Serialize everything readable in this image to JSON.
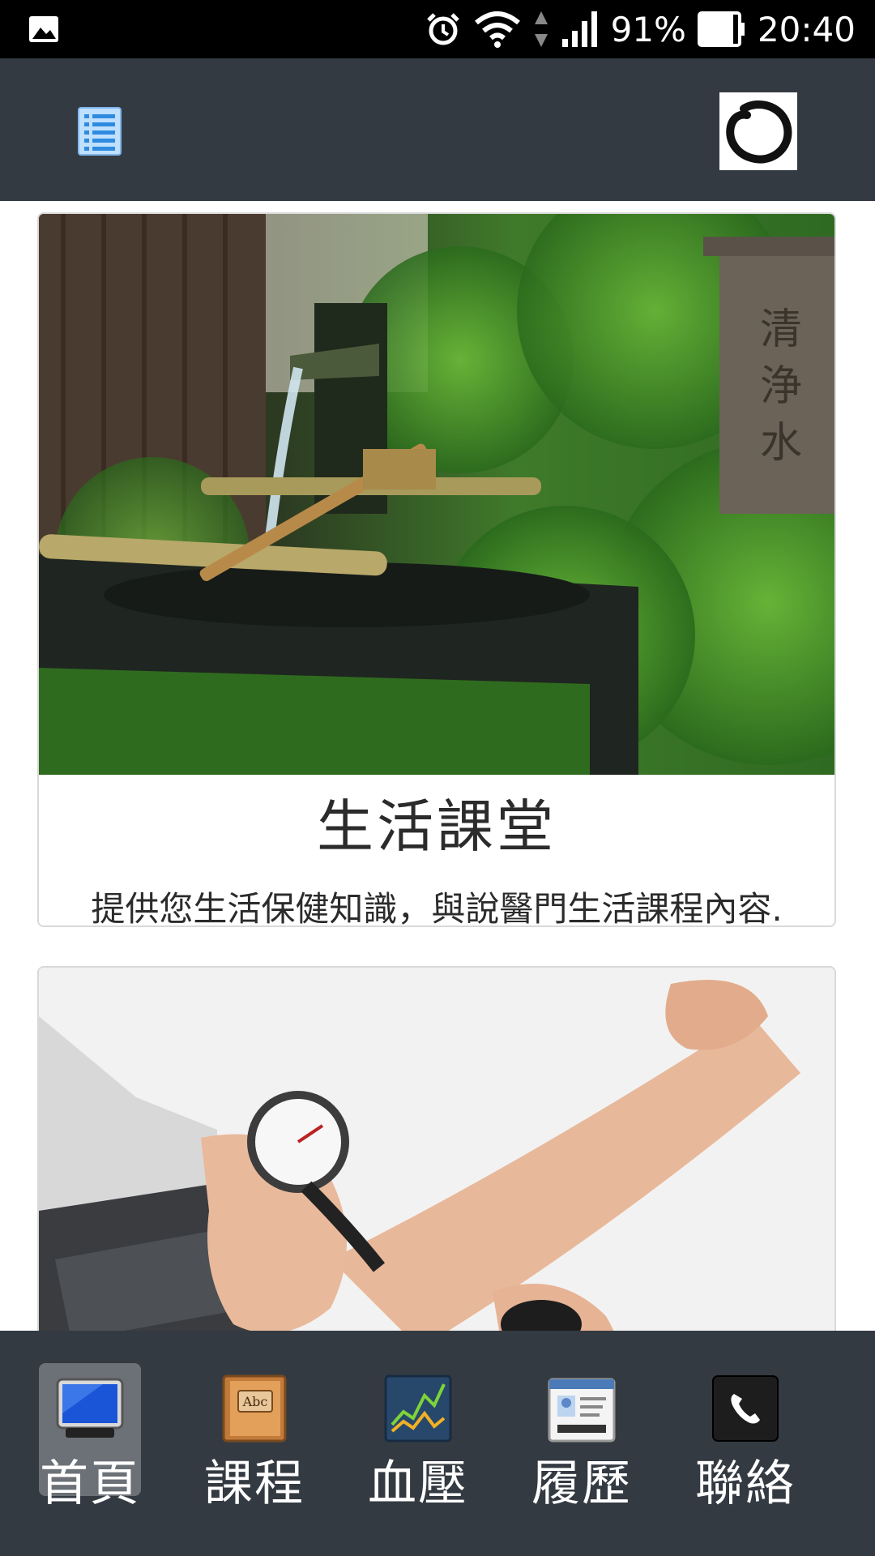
{
  "status_bar": {
    "battery": "91%",
    "time": "20:40"
  },
  "app_bar": {
    "menu_icon": "list-menu-icon",
    "logo_icon": "enso-circle-logo-icon"
  },
  "cards": [
    {
      "image": "japanese-garden-bamboo-fountain-photo",
      "title": "生活課堂",
      "description": "提供您生活保健知識，與說醫門生活課程內容."
    },
    {
      "image": "blood-pressure-measurement-photo"
    }
  ],
  "bottom_nav": {
    "active_index": 0,
    "items": [
      {
        "label": "首頁",
        "icon": "monitor-icon"
      },
      {
        "label": "課程",
        "icon": "book-icon"
      },
      {
        "label": "血壓",
        "icon": "chart-icon"
      },
      {
        "label": "履歷",
        "icon": "id-card-icon"
      },
      {
        "label": "聯絡",
        "icon": "phone-icon"
      }
    ]
  },
  "colors": {
    "appbar_bg": "#343a42",
    "active_tab_bg": "#6c7077",
    "statusbar_bg": "#000000"
  }
}
